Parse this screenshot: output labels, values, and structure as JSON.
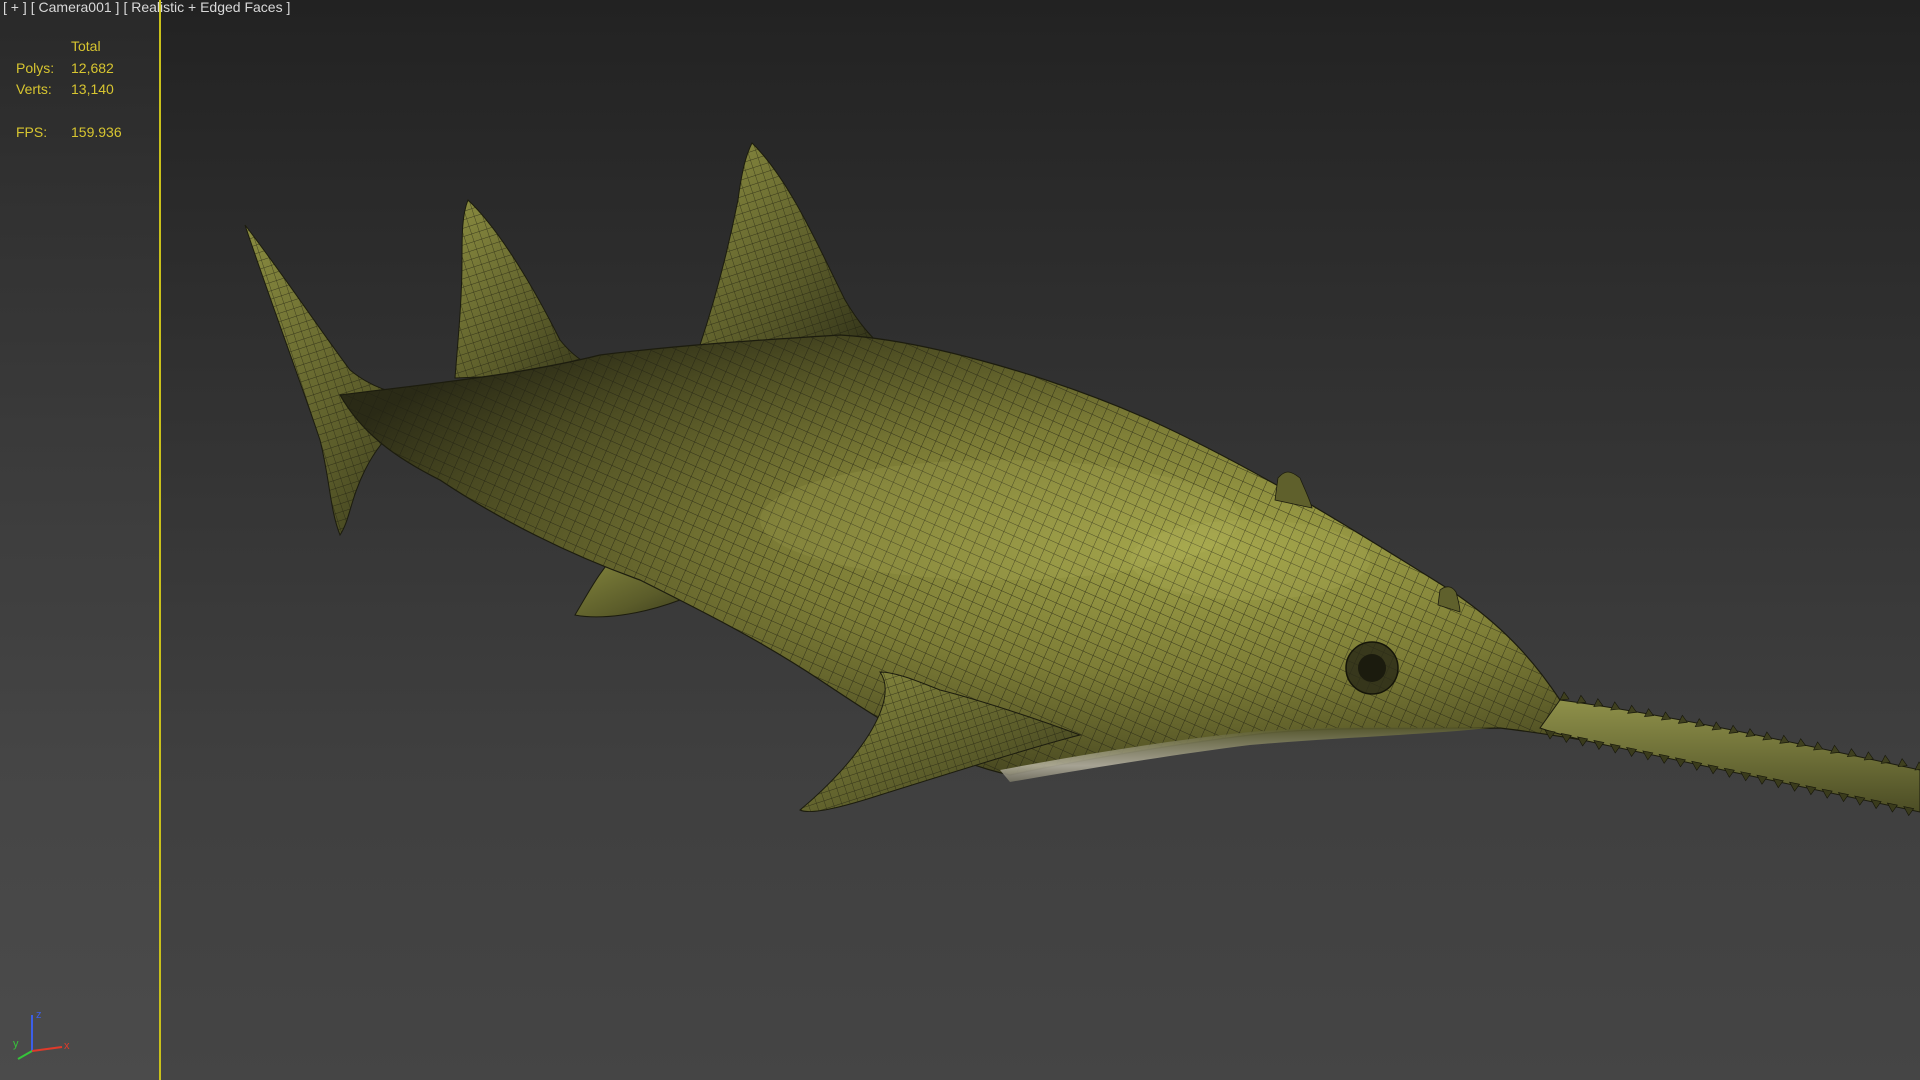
{
  "viewport": {
    "plus_label": "[ + ]",
    "camera_label": "[ Camera001 ]",
    "shading_label": "[ Realistic + Edged Faces ]"
  },
  "stats": {
    "header": "Total",
    "polys_label": "Polys:",
    "polys_value": "12,682",
    "verts_label": "Verts:",
    "verts_value": "13,140",
    "fps_label": "FPS:",
    "fps_value": "159.936"
  },
  "axis": {
    "x_label": "x",
    "y_label": "y",
    "z_label": "z",
    "x_color": "#e03a2a",
    "y_color": "#36c43a",
    "z_color": "#3c5fe8"
  },
  "colors": {
    "frame_line": "#c9c11a",
    "stats_text": "#d7c530",
    "model_body": "#7a7a32"
  },
  "model": {
    "subject": "sawfish"
  }
}
